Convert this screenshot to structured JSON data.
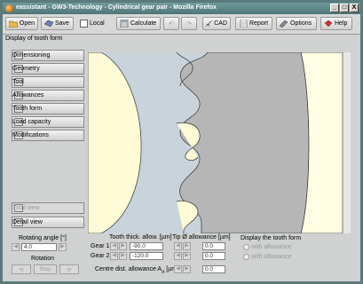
{
  "window": {
    "title": "eassistant - GW3-Technology - Cylindrical gear pair - Mozilla Firefox",
    "controls": [
      "_",
      "□",
      "X"
    ]
  },
  "toolbar": {
    "open": "Open",
    "save": "Save",
    "local": "Local",
    "calculate": "Calculate",
    "cad": "CAD",
    "report": "Report",
    "options": "Options",
    "help": "Help"
  },
  "section_label": "Display of tooth form",
  "sidebar": {
    "items": [
      {
        "label": "Dimensioning",
        "icon": "dimensioning-icon"
      },
      {
        "label": "Geometry",
        "icon": "geometry-icon"
      },
      {
        "label": "Tool",
        "icon": "tool-icon"
      },
      {
        "label": "Allowances",
        "icon": "allowances-icon"
      },
      {
        "label": "Tooth form",
        "icon": "tooth-form-icon"
      },
      {
        "label": "Load capacity",
        "icon": "load-capacity-icon"
      },
      {
        "label": "Modifications",
        "icon": "modifications-icon"
      }
    ],
    "total_view": "Total view",
    "detail_view": "Detail view"
  },
  "bottom": {
    "rotating_angle_label": "Rotating angle [°]",
    "rotating_angle_value": "4.0",
    "rotation_label": "Rotation",
    "stop_label": "Stop",
    "tooth_thick_label": "Tooth thick. allow. [µm]",
    "tip_allowance_label": "Tip Ø allowance [µm]",
    "gear1_label": "Gear 1",
    "gear2_label": "Gear 2",
    "gear1_thick": "-90.0",
    "gear2_thick": "-120.0",
    "gear1_tip": "0.0",
    "gear2_tip": "0.0",
    "centre_dist_label": "Centre dist. allowance A",
    "centre_dist_sub": "a",
    "centre_dist_unit": " [µm]",
    "centre_dist_value": "0.0",
    "display_label": "Display the tooth form",
    "with_allowance": "with allowance",
    "with_allowance_2": "with allowance"
  },
  "colors": {
    "canvas_bg": "#fffde4",
    "gear_blue": "#c8d3dc",
    "gear_gray": "#b6b6b6",
    "gear_cream": "#fffbd6",
    "window_frame": "#5b7a7c"
  }
}
